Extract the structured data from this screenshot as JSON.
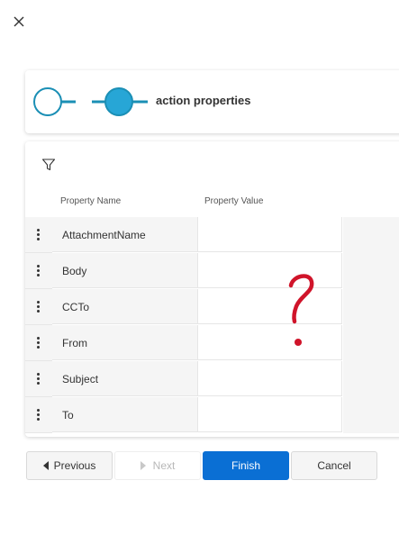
{
  "colors": {
    "accent": "#0a6fd4",
    "step_ring": "#1b8fb5",
    "step_active": "#27a6d6",
    "annotation": "#d0142a"
  },
  "stepper": {
    "step_label": "action properties",
    "current_step": 2,
    "total_steps": 2
  },
  "grid": {
    "columns": {
      "name": "Property Name",
      "value": "Property Value"
    },
    "rows": [
      {
        "name": "AttachmentName",
        "value": ""
      },
      {
        "name": "Body",
        "value": ""
      },
      {
        "name": "CCTo",
        "value": ""
      },
      {
        "name": "From",
        "value": ""
      },
      {
        "name": "Subject",
        "value": ""
      },
      {
        "name": "To",
        "value": ""
      }
    ]
  },
  "annotation": {
    "text": "?"
  },
  "footer": {
    "previous_label": "Previous",
    "next_label": "Next",
    "finish_label": "Finish",
    "cancel_label": "Cancel"
  },
  "icons": {
    "close": "close-icon",
    "filter": "filter-icon",
    "row_menu": "more-vertical-icon",
    "previous": "caret-left-icon",
    "next": "caret-right-icon"
  }
}
